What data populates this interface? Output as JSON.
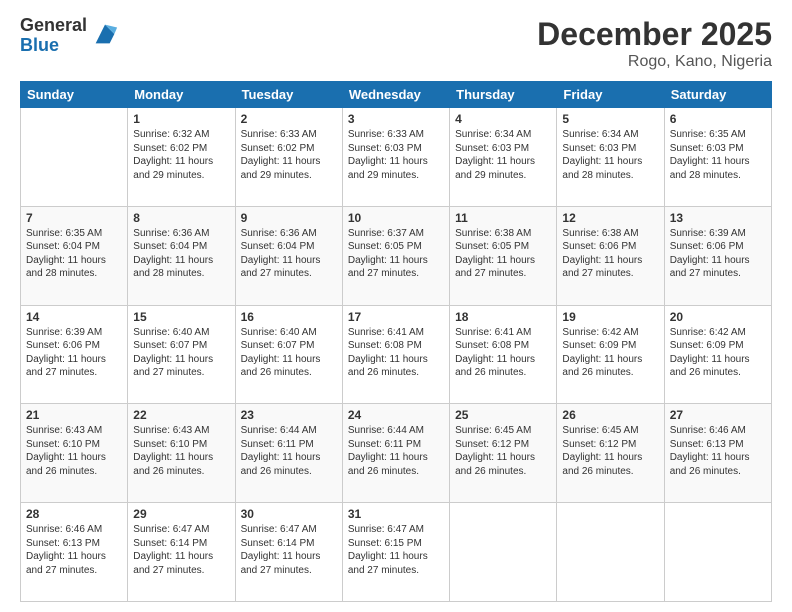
{
  "logo": {
    "general": "General",
    "blue": "Blue"
  },
  "header": {
    "month": "December 2025",
    "location": "Rogo, Kano, Nigeria"
  },
  "days": [
    "Sunday",
    "Monday",
    "Tuesday",
    "Wednesday",
    "Thursday",
    "Friday",
    "Saturday"
  ],
  "weeks": [
    [
      {
        "day": "",
        "info": ""
      },
      {
        "day": "1",
        "info": "Sunrise: 6:32 AM\nSunset: 6:02 PM\nDaylight: 11 hours\nand 29 minutes."
      },
      {
        "day": "2",
        "info": "Sunrise: 6:33 AM\nSunset: 6:02 PM\nDaylight: 11 hours\nand 29 minutes."
      },
      {
        "day": "3",
        "info": "Sunrise: 6:33 AM\nSunset: 6:03 PM\nDaylight: 11 hours\nand 29 minutes."
      },
      {
        "day": "4",
        "info": "Sunrise: 6:34 AM\nSunset: 6:03 PM\nDaylight: 11 hours\nand 29 minutes."
      },
      {
        "day": "5",
        "info": "Sunrise: 6:34 AM\nSunset: 6:03 PM\nDaylight: 11 hours\nand 28 minutes."
      },
      {
        "day": "6",
        "info": "Sunrise: 6:35 AM\nSunset: 6:03 PM\nDaylight: 11 hours\nand 28 minutes."
      }
    ],
    [
      {
        "day": "7",
        "info": "Sunrise: 6:35 AM\nSunset: 6:04 PM\nDaylight: 11 hours\nand 28 minutes."
      },
      {
        "day": "8",
        "info": "Sunrise: 6:36 AM\nSunset: 6:04 PM\nDaylight: 11 hours\nand 28 minutes."
      },
      {
        "day": "9",
        "info": "Sunrise: 6:36 AM\nSunset: 6:04 PM\nDaylight: 11 hours\nand 27 minutes."
      },
      {
        "day": "10",
        "info": "Sunrise: 6:37 AM\nSunset: 6:05 PM\nDaylight: 11 hours\nand 27 minutes."
      },
      {
        "day": "11",
        "info": "Sunrise: 6:38 AM\nSunset: 6:05 PM\nDaylight: 11 hours\nand 27 minutes."
      },
      {
        "day": "12",
        "info": "Sunrise: 6:38 AM\nSunset: 6:06 PM\nDaylight: 11 hours\nand 27 minutes."
      },
      {
        "day": "13",
        "info": "Sunrise: 6:39 AM\nSunset: 6:06 PM\nDaylight: 11 hours\nand 27 minutes."
      }
    ],
    [
      {
        "day": "14",
        "info": "Sunrise: 6:39 AM\nSunset: 6:06 PM\nDaylight: 11 hours\nand 27 minutes."
      },
      {
        "day": "15",
        "info": "Sunrise: 6:40 AM\nSunset: 6:07 PM\nDaylight: 11 hours\nand 27 minutes."
      },
      {
        "day": "16",
        "info": "Sunrise: 6:40 AM\nSunset: 6:07 PM\nDaylight: 11 hours\nand 26 minutes."
      },
      {
        "day": "17",
        "info": "Sunrise: 6:41 AM\nSunset: 6:08 PM\nDaylight: 11 hours\nand 26 minutes."
      },
      {
        "day": "18",
        "info": "Sunrise: 6:41 AM\nSunset: 6:08 PM\nDaylight: 11 hours\nand 26 minutes."
      },
      {
        "day": "19",
        "info": "Sunrise: 6:42 AM\nSunset: 6:09 PM\nDaylight: 11 hours\nand 26 minutes."
      },
      {
        "day": "20",
        "info": "Sunrise: 6:42 AM\nSunset: 6:09 PM\nDaylight: 11 hours\nand 26 minutes."
      }
    ],
    [
      {
        "day": "21",
        "info": "Sunrise: 6:43 AM\nSunset: 6:10 PM\nDaylight: 11 hours\nand 26 minutes."
      },
      {
        "day": "22",
        "info": "Sunrise: 6:43 AM\nSunset: 6:10 PM\nDaylight: 11 hours\nand 26 minutes."
      },
      {
        "day": "23",
        "info": "Sunrise: 6:44 AM\nSunset: 6:11 PM\nDaylight: 11 hours\nand 26 minutes."
      },
      {
        "day": "24",
        "info": "Sunrise: 6:44 AM\nSunset: 6:11 PM\nDaylight: 11 hours\nand 26 minutes."
      },
      {
        "day": "25",
        "info": "Sunrise: 6:45 AM\nSunset: 6:12 PM\nDaylight: 11 hours\nand 26 minutes."
      },
      {
        "day": "26",
        "info": "Sunrise: 6:45 AM\nSunset: 6:12 PM\nDaylight: 11 hours\nand 26 minutes."
      },
      {
        "day": "27",
        "info": "Sunrise: 6:46 AM\nSunset: 6:13 PM\nDaylight: 11 hours\nand 26 minutes."
      }
    ],
    [
      {
        "day": "28",
        "info": "Sunrise: 6:46 AM\nSunset: 6:13 PM\nDaylight: 11 hours\nand 27 minutes."
      },
      {
        "day": "29",
        "info": "Sunrise: 6:47 AM\nSunset: 6:14 PM\nDaylight: 11 hours\nand 27 minutes."
      },
      {
        "day": "30",
        "info": "Sunrise: 6:47 AM\nSunset: 6:14 PM\nDaylight: 11 hours\nand 27 minutes."
      },
      {
        "day": "31",
        "info": "Sunrise: 6:47 AM\nSunset: 6:15 PM\nDaylight: 11 hours\nand 27 minutes."
      },
      {
        "day": "",
        "info": ""
      },
      {
        "day": "",
        "info": ""
      },
      {
        "day": "",
        "info": ""
      }
    ]
  ]
}
